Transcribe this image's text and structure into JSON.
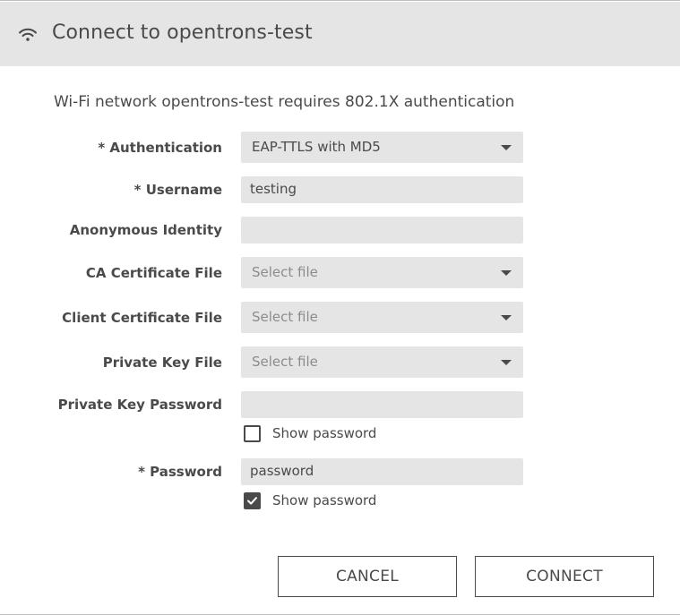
{
  "dialog": {
    "title": "Connect to opentrons-test",
    "icon": "wifi-icon",
    "subtitle": "Wi-Fi network opentrons-test requires 802.1X authentication"
  },
  "form": {
    "authentication": {
      "label": "* Authentication",
      "value": "EAP-TTLS with MD5"
    },
    "username": {
      "label": "* Username",
      "value": "testing"
    },
    "anonymous_identity": {
      "label": "Anonymous Identity",
      "value": ""
    },
    "ca_certificate_file": {
      "label": "CA Certificate File",
      "placeholder": "Select file"
    },
    "client_certificate_file": {
      "label": "Client Certificate File",
      "placeholder": "Select file"
    },
    "private_key_file": {
      "label": "Private Key File",
      "placeholder": "Select file"
    },
    "private_key_password": {
      "label": "Private Key Password",
      "value": "",
      "show_password_label": "Show password",
      "show_password_checked": false
    },
    "password": {
      "label": "* Password",
      "value": "password",
      "show_password_label": "Show password",
      "show_password_checked": true
    }
  },
  "buttons": {
    "cancel": "CANCEL",
    "connect": "CONNECT"
  }
}
